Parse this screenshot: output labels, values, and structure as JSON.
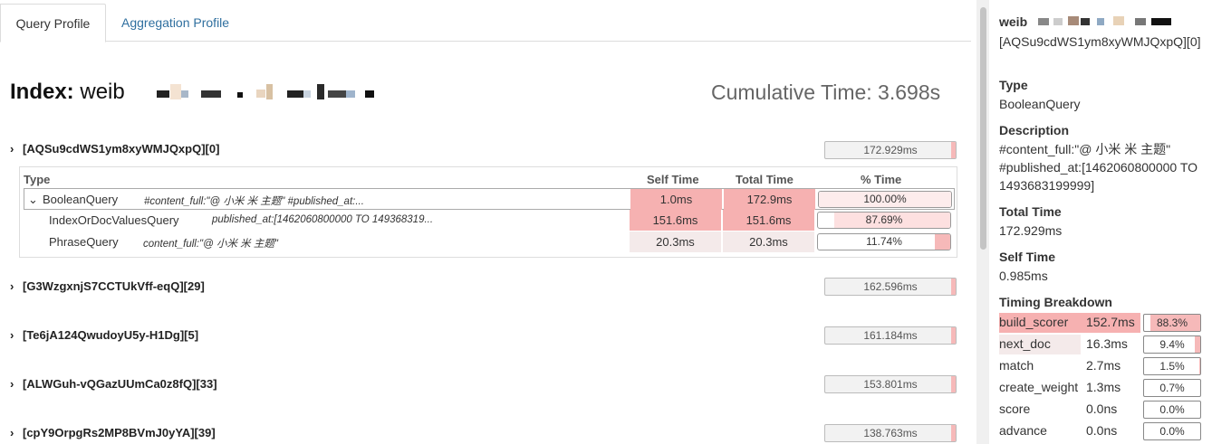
{
  "tabs": [
    {
      "label": "Query Profile",
      "active": true
    },
    {
      "label": "Aggregation Profile",
      "active": false
    }
  ],
  "index": {
    "prefix": "Index:",
    "name": "weib",
    "cumulative_time": "Cumulative Time: 3.698s"
  },
  "shards": [
    {
      "id": "[AQSu9cdWS1ym8xyWMJQxpQ][0]",
      "time": "172.929ms",
      "fill": 0.04,
      "expanded": true
    },
    {
      "id": "[G3WzgxnjS7CCTUkVff-eqQ][29]",
      "time": "162.596ms",
      "fill": 0.04,
      "expanded": false
    },
    {
      "id": "[Te6jA124QwudoyU5y-H1Dg][5]",
      "time": "161.184ms",
      "fill": 0.04,
      "expanded": false
    },
    {
      "id": "[ALWGuh-vQGazUUmCa0z8fQ][33]",
      "time": "153.801ms",
      "fill": 0.04,
      "expanded": false
    },
    {
      "id": "[cpY9OrpgRs2MP8BVmJ0yYA][39]",
      "time": "138.763ms",
      "fill": 0.04,
      "expanded": false
    }
  ],
  "table": {
    "headers": {
      "type": "Type",
      "self": "Self Time",
      "total": "Total Time",
      "pct": "% Time"
    },
    "rows": [
      {
        "name": "BooleanQuery",
        "desc": "#content_full:\"@ 小米 米 主题\" #published_at:...",
        "self": "1.0ms",
        "total": "172.9ms",
        "pct": "100.00%",
        "pct_value": 100.0
      },
      {
        "name": "IndexOrDocValuesQuery",
        "desc": "published_at:[1462060800000 TO 149368319...",
        "self": "151.6ms",
        "total": "151.6ms",
        "pct": "87.69%",
        "pct_value": 87.69
      },
      {
        "name": "PhraseQuery",
        "desc": "content_full:\"@ 小米 米 主题\"",
        "self": "20.3ms",
        "total": "20.3ms",
        "pct": "11.74%",
        "pct_value": 11.74
      }
    ]
  },
  "detail": {
    "title": "weib",
    "shard": "[AQSu9cdWS1ym8xyWMJQxpQ][0]",
    "type_label": "Type",
    "type_value": "BooleanQuery",
    "desc_label": "Description",
    "desc_line1": "#content_full:\"@ 小米 米 主题\"",
    "desc_line2": "#published_at:[1462060800000 TO",
    "desc_line3": "1493683199999]",
    "total_label": "Total Time",
    "total_value": "172.929ms",
    "self_label": "Self Time",
    "self_value": "0.985ms",
    "breakdown_label": "Timing Breakdown",
    "breakdown": [
      {
        "name": "build_scorer",
        "time": "152.7ms",
        "pct": "88.3%",
        "pct_value": 88.3
      },
      {
        "name": "next_doc",
        "time": "16.3ms",
        "pct": "9.4%",
        "pct_value": 9.4
      },
      {
        "name": "match",
        "time": "2.7ms",
        "pct": "1.5%",
        "pct_value": 1.5
      },
      {
        "name": "create_weight",
        "time": "1.3ms",
        "pct": "0.7%",
        "pct_value": 0.7
      },
      {
        "name": "score",
        "time": "0.0ns",
        "pct": "0.0%",
        "pct_value": 0.0
      },
      {
        "name": "advance",
        "time": "0.0ns",
        "pct": "0.0%",
        "pct_value": 0.0
      }
    ]
  },
  "colors": {
    "heat_strong": "#f6b1b1",
    "heat_light": "#f4eaea",
    "accent_link": "#2f6f9f"
  }
}
